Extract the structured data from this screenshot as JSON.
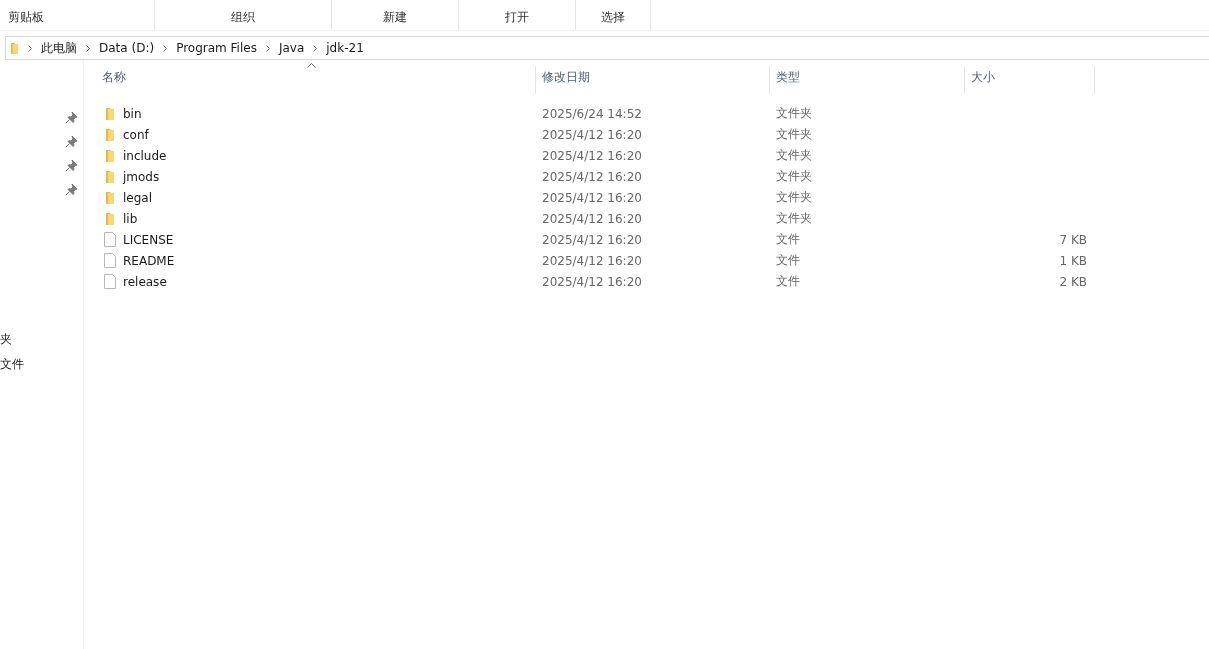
{
  "ribbon_groups": [
    "剪贴板",
    "组织",
    "新建",
    "打开",
    "选择"
  ],
  "address_bar": {
    "path": [
      "此电脑",
      "Data (D:)",
      "Program Files",
      "Java",
      "jdk-21"
    ]
  },
  "nav_pane": {
    "items": [
      "夹",
      "文件"
    ]
  },
  "file_list": {
    "columns": [
      "名称",
      "修改日期",
      "类型",
      "大小"
    ],
    "rows": [
      {
        "kind": "folder",
        "name": "bin",
        "date": "2025/6/24 14:52",
        "type": "文件夹"
      },
      {
        "kind": "folder",
        "name": "conf",
        "date": "2025/4/12 16:20",
        "type": "文件夹"
      },
      {
        "kind": "folder",
        "name": "include",
        "date": "2025/4/12 16:20",
        "type": "文件夹"
      },
      {
        "kind": "folder",
        "name": "jmods",
        "date": "2025/4/12 16:20",
        "type": "文件夹"
      },
      {
        "kind": "folder",
        "name": "legal",
        "date": "2025/4/12 16:20",
        "type": "文件夹"
      },
      {
        "kind": "folder",
        "name": "lib",
        "date": "2025/4/12 16:20",
        "type": "文件夹"
      },
      {
        "kind": "file",
        "name": "LICENSE",
        "date": "2025/4/12 16:20",
        "type": "文件",
        "size": "7 KB"
      },
      {
        "kind": "file",
        "name": "README",
        "date": "2025/4/12 16:20",
        "type": "文件",
        "size": "1 KB"
      },
      {
        "kind": "file",
        "name": "release",
        "date": "2025/4/12 16:20",
        "type": "文件",
        "size": "2 KB"
      }
    ]
  }
}
